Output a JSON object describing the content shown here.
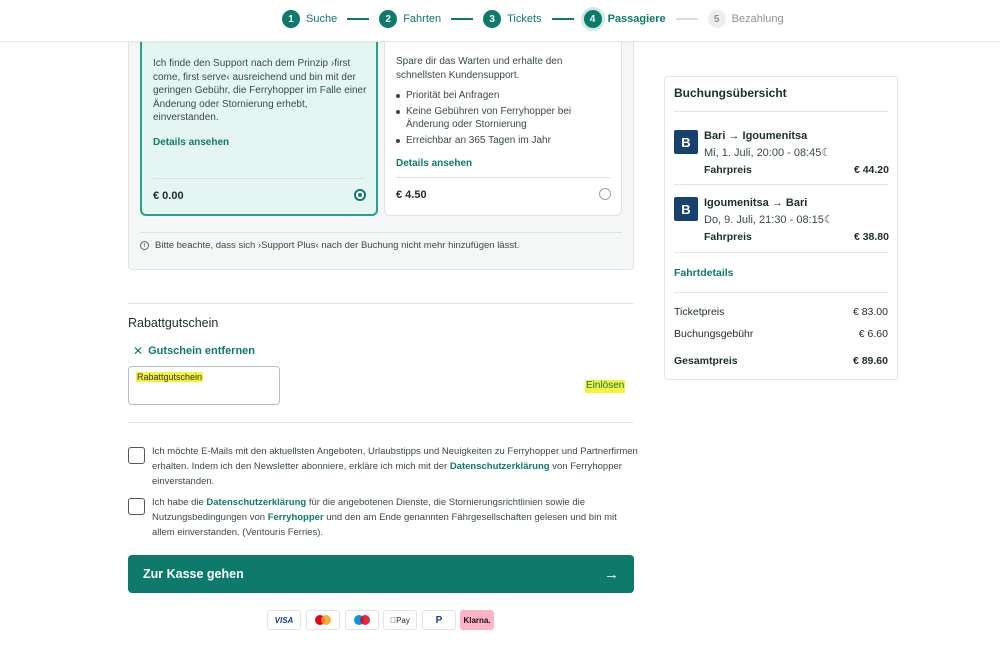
{
  "stepper": {
    "steps": [
      {
        "num": "1",
        "label": "Suche"
      },
      {
        "num": "2",
        "label": "Fahrten"
      },
      {
        "num": "3",
        "label": "Tickets"
      },
      {
        "num": "4",
        "label": "Passagiere"
      },
      {
        "num": "5",
        "label": "Bezahlung"
      }
    ]
  },
  "support": {
    "basic": {
      "text": "Ich finde den Support nach dem Prinzip ›first come, first serve‹ ausreichend und bin mit der geringen Gebühr, die Ferryhopper im Falle einer Änderung oder Stornierung erhebt, einverstanden.",
      "link": "Details ansehen",
      "price": "€ 0.00",
      "selected": true
    },
    "plus": {
      "text": "Spare dir das Warten und erhalte den schnellsten Kundensupport.",
      "bullets": [
        "Priorität bei Anfragen",
        "Keine Gebühren von Ferryhopper bei Änderung oder Stornierung",
        "Erreichbar an 365 Tagen im Jahr"
      ],
      "link": "Details ansehen",
      "price": "€ 4.50",
      "selected": false
    },
    "note": "Bitte beachte, dass sich ›Support Plus‹ nach der Buchung nicht mehr hinzufügen lässt."
  },
  "coupon": {
    "title": "Rabattgutschein",
    "remove_label": "Gutschein entfernen",
    "input_value": "Rabattgutschein",
    "redeem_label": "Einlösen"
  },
  "consents": {
    "newsletter": {
      "before": "Ich möchte E-Mails mit den aktuellsten Angeboten, Urlaubstipps und Neuigkeiten zu Ferryhopper und Partnerfirmen erhalten. Indem ich den Newsletter abonniere, erkläre ich mich mit der ",
      "link": "Datenschutzerklärung",
      "after": " von Ferryhopper einverstanden."
    },
    "terms": {
      "part1": "Ich habe die ",
      "link1": "Datenschutzerklärung",
      "part2": " für die angebotenen Dienste, die Stornierungsrichtlinien sowie die Nutzungsbedingungen von ",
      "link2": "Ferryhopper",
      "part3": " und den am Ende genannten Fährgesellschaften gelesen und bin mit allem einverstanden. (Ventouris Ferries)."
    }
  },
  "checkout": {
    "label": "Zur Kasse gehen",
    "arrow": "→"
  },
  "payment_methods": [
    "VISA",
    "Mastercard",
    "Maestro",
    "Apple Pay",
    "PayPal",
    "Klarna."
  ],
  "summary": {
    "title": "Buchungsübersicht",
    "trips": [
      {
        "route": "Bari → Igoumenitsa",
        "time": "Mi, 1. Juli, 20:00 - 08:45☾",
        "fare_label": "Fahrpreis",
        "price": "€ 44.20"
      },
      {
        "route": "Igoumenitsa → Bari",
        "time": "Do, 9. Juli, 21:30 - 08:15☾",
        "fare_label": "Fahrpreis",
        "price": "€ 38.80"
      }
    ],
    "details_link": "Fahrtdetails",
    "ticket_label": "Ticketpreis",
    "ticket_value": "€ 83.00",
    "fee_label": "Buchungsgebühr",
    "fee_value": "€ 6.60",
    "total_label": "Gesamtpreis",
    "total_value": "€ 89.60"
  },
  "colors": {
    "accent": "#0d7a6b",
    "selected_card_bg": "#e5f6f2",
    "highlight": "#f5f23a",
    "ship_logo": "#18416e"
  },
  "icons": {
    "step_done": "number-circle",
    "info": "info-icon",
    "remove": "close-icon",
    "arrow": "arrow-right-icon",
    "ship": "ferry-company-logo-icon",
    "night": "moon-icon"
  }
}
